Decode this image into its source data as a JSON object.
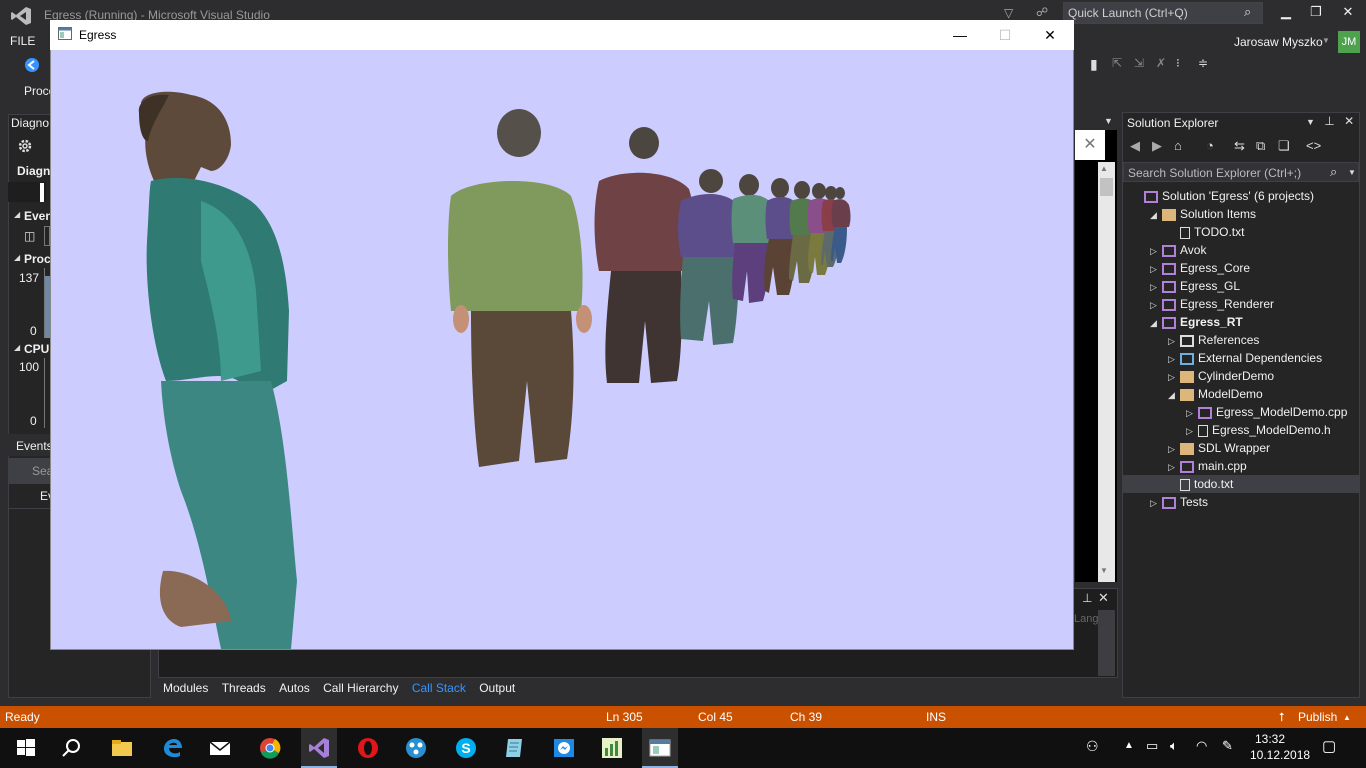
{
  "vs": {
    "window_title": "Egress (Running) - Microsoft Visual Studio",
    "quick_launch_placeholder": "Quick Launch (Ctrl+Q)",
    "user_name": "Jarosaw Myszko",
    "user_initials": "JM",
    "menu_file": "FILE",
    "process_label": "Proce"
  },
  "diagnostics": {
    "title": "Diagno",
    "tab_label": "Diagn",
    "events_header": "Even",
    "process_header": "Proc",
    "process_max": "137",
    "process_min": "0",
    "cpu_header": "CPU",
    "cpu_max": "100",
    "cpu_min": "0",
    "events_tab": "Events",
    "search_placeholder": "Sea",
    "event_col": "Ev"
  },
  "egress": {
    "title": "Egress",
    "minimize": "—",
    "maximize": "☐",
    "close": "✕",
    "background_color": "#ccccff"
  },
  "lower_tabs": [
    {
      "label": "Modules"
    },
    {
      "label": "Threads"
    },
    {
      "label": "Autos"
    },
    {
      "label": "Call Hierarchy"
    },
    {
      "label": "Call Stack"
    },
    {
      "label": "Output"
    }
  ],
  "lower_panel_lang": "Lang",
  "solution_explorer": {
    "title": "Solution Explorer",
    "search_placeholder": "Search Solution Explorer (Ctrl+;)",
    "items": [
      {
        "label": "Solution 'Egress' (6 projects)",
        "depth": 0,
        "expander": "",
        "icon": "solution-icon"
      },
      {
        "label": "Solution Items",
        "depth": 1,
        "expander": "◢",
        "icon": "folder-icon"
      },
      {
        "label": "TODO.txt",
        "depth": 2,
        "expander": "",
        "icon": "text-file-icon"
      },
      {
        "label": "Avok",
        "depth": 1,
        "expander": "▷",
        "icon": "project-icon"
      },
      {
        "label": "Egress_Core",
        "depth": 1,
        "expander": "▷",
        "icon": "project-icon"
      },
      {
        "label": "Egress_GL",
        "depth": 1,
        "expander": "▷",
        "icon": "project-icon"
      },
      {
        "label": "Egress_Renderer",
        "depth": 1,
        "expander": "▷",
        "icon": "project-icon"
      },
      {
        "label": "Egress_RT",
        "depth": 1,
        "expander": "◢",
        "icon": "project-icon",
        "bold": true
      },
      {
        "label": "References",
        "depth": 2,
        "expander": "▷",
        "icon": "references-icon"
      },
      {
        "label": "External Dependencies",
        "depth": 2,
        "expander": "▷",
        "icon": "external-deps-icon"
      },
      {
        "label": "CylinderDemo",
        "depth": 2,
        "expander": "▷",
        "icon": "folder-icon"
      },
      {
        "label": "ModelDemo",
        "depth": 2,
        "expander": "◢",
        "icon": "folder-icon"
      },
      {
        "label": "Egress_ModelDemo.cpp",
        "depth": 3,
        "expander": "▷",
        "icon": "cpp-file-icon"
      },
      {
        "label": "Egress_ModelDemo.h",
        "depth": 3,
        "expander": "▷",
        "icon": "header-file-icon"
      },
      {
        "label": "SDL Wrapper",
        "depth": 2,
        "expander": "▷",
        "icon": "folder-icon"
      },
      {
        "label": "main.cpp",
        "depth": 2,
        "expander": "▷",
        "icon": "cpp-file-icon"
      },
      {
        "label": "todo.txt",
        "depth": 2,
        "expander": "",
        "icon": "text-file-icon",
        "selected": true
      },
      {
        "label": "Tests",
        "depth": 1,
        "expander": "▷",
        "icon": "project-icon"
      }
    ]
  },
  "status_bar": {
    "state": "Ready",
    "line": "Ln 305",
    "col": "Col 45",
    "ch": "Ch 39",
    "mode": "INS",
    "publish": "Publish"
  },
  "taskbar": {
    "time": "13:32",
    "date": "10.12.2018",
    "apps": [
      "start-icon",
      "search-icon",
      "file-explorer-icon",
      "edge-icon",
      "mail-icon",
      "chrome-icon",
      "visual-studio-icon",
      "opera-icon",
      "app-icon",
      "skype-icon",
      "notepad-icon",
      "messenger-icon",
      "chart-app-icon",
      "egress-app-icon"
    ]
  },
  "colors": {
    "status_bar": "#ca5100",
    "accent": "#3794ff"
  }
}
